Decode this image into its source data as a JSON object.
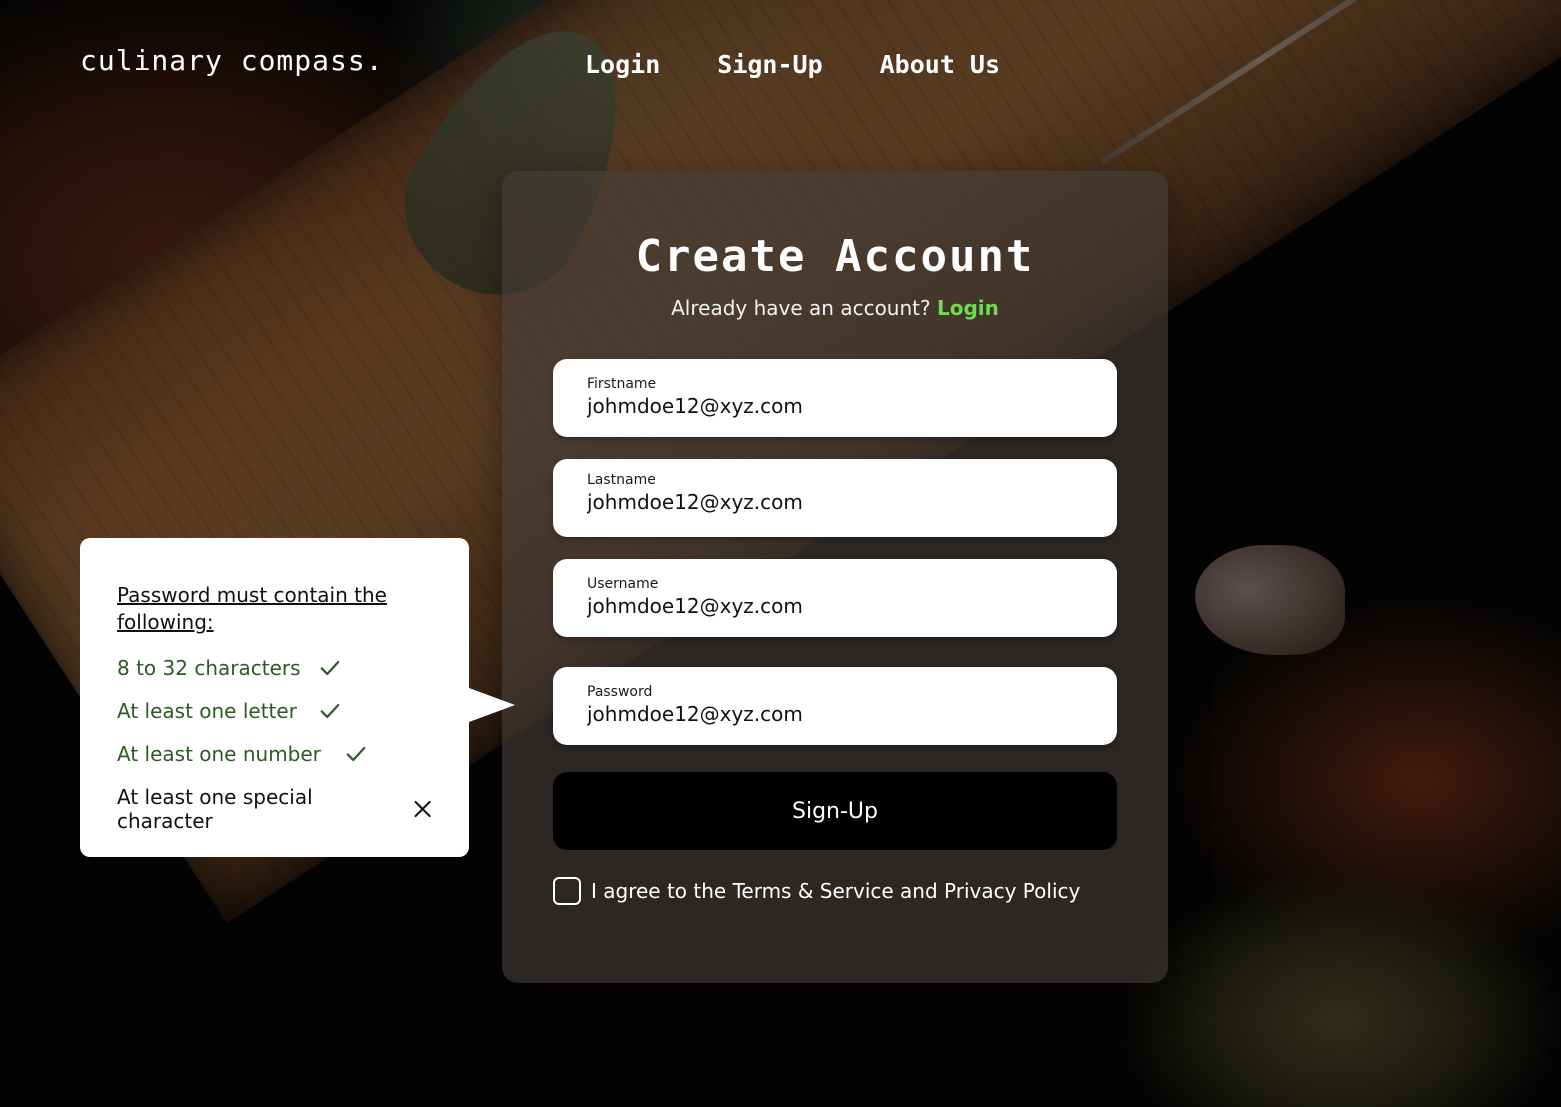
{
  "header": {
    "logo": "culinary compass.",
    "nav": [
      {
        "label": "Login"
      },
      {
        "label": "Sign-Up"
      },
      {
        "label": "About Us"
      }
    ]
  },
  "card": {
    "title": "Create Account",
    "subtitle_prefix": "Already have an account?",
    "subtitle_link": "Login",
    "fields": [
      {
        "label": "Firstname",
        "value": "johmdoe12@xyz.com"
      },
      {
        "label": "Lastname",
        "value": "johmdoe12@xyz.com"
      },
      {
        "label": "Username",
        "value": "johmdoe12@xyz.com"
      },
      {
        "label": "Password",
        "value": "johmdoe12@xyz.com"
      }
    ],
    "submit_label": "Sign-Up",
    "agree_text": "I agree to the Terms & Service and Privacy Policy",
    "agree_checked": false
  },
  "tooltip": {
    "heading": "Password must contain the following:",
    "rules": [
      {
        "text": "8 to 32 characters",
        "met": true,
        "icon": "check-icon"
      },
      {
        "text": "At least one letter",
        "met": true,
        "icon": "check-icon"
      },
      {
        "text": "At least one number",
        "met": true,
        "icon": "check-icon"
      },
      {
        "text": "At least one special character",
        "met": false,
        "icon": "x-icon"
      }
    ]
  },
  "colors": {
    "link_green": "#6ddc4f",
    "rule_ok": "#2e5a25",
    "rule_fail": "#111111",
    "button_bg": "#000000"
  }
}
